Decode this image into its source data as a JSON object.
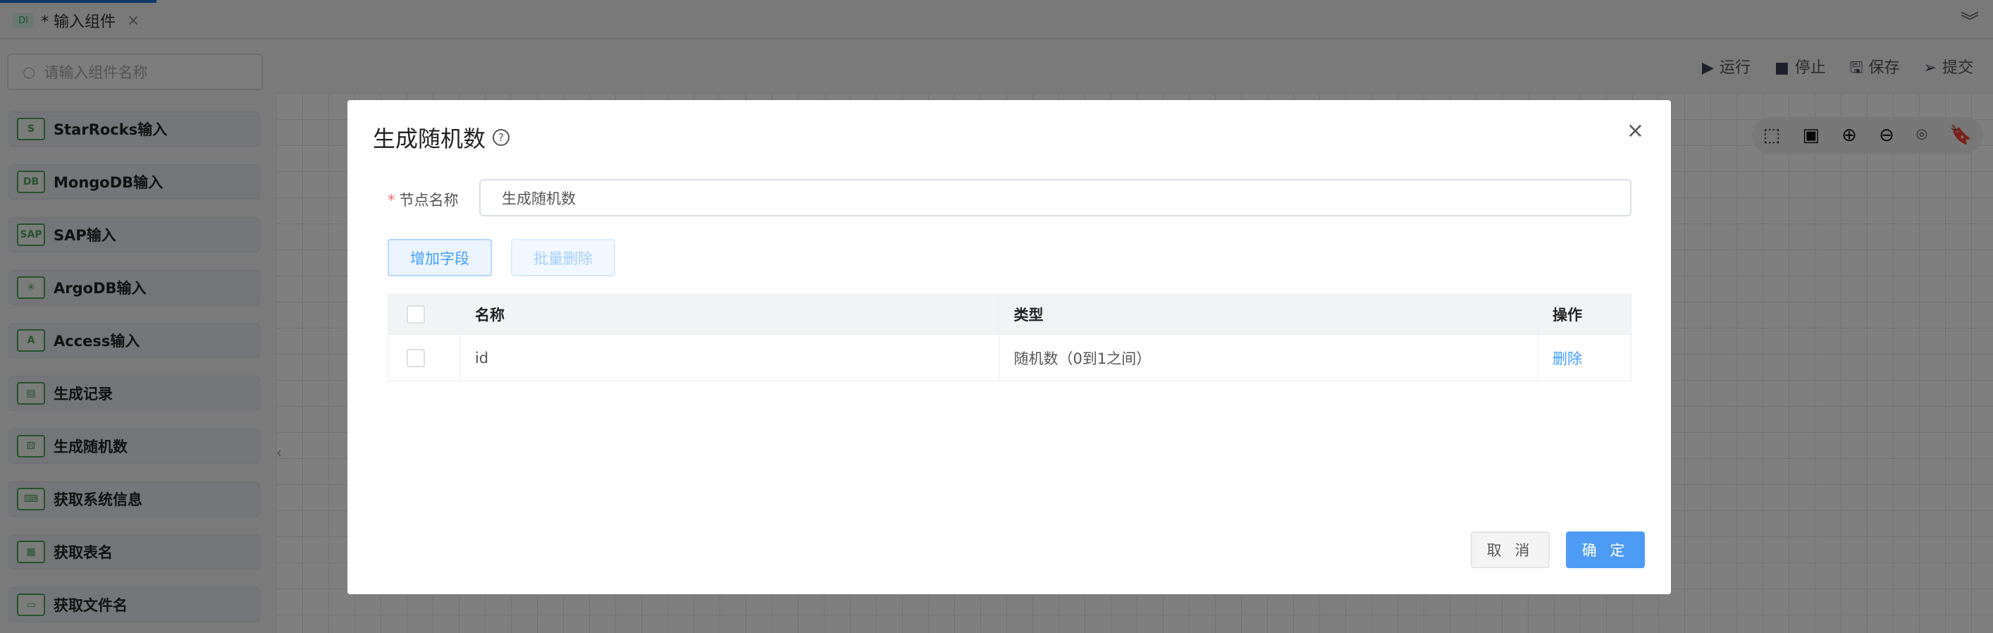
{
  "tab": {
    "badge": "DI",
    "title": "* 输入组件",
    "close": "×"
  },
  "collapse_icon": "︾",
  "search": {
    "placeholder": "请输入组件名称"
  },
  "actions": [
    {
      "icon": "▶",
      "label": "运行"
    },
    {
      "icon": "■",
      "label": "停止"
    },
    {
      "icon": "🖫",
      "label": "保存"
    },
    {
      "icon": "➢",
      "label": "提交"
    }
  ],
  "sidebar": {
    "items": [
      {
        "label": "StarRocks输入",
        "icon": "S"
      },
      {
        "label": "MongoDB输入",
        "icon": "DB"
      },
      {
        "label": "SAP输入",
        "icon": "SAP"
      },
      {
        "label": "ArgoDB输入",
        "icon": "✳"
      },
      {
        "label": "Access输入",
        "icon": "A"
      },
      {
        "label": "生成记录",
        "icon": "▤"
      },
      {
        "label": "生成随机数",
        "icon": "⚄"
      },
      {
        "label": "获取系统信息",
        "icon": "⌨"
      },
      {
        "label": "获取表名",
        "icon": "▦"
      },
      {
        "label": "获取文件名",
        "icon": "▭"
      }
    ]
  },
  "zoom_tools": [
    "⬚",
    "▣",
    "⊕",
    "⊖",
    "⌾",
    "🔖"
  ],
  "modal": {
    "title": "生成随机数",
    "help": "?",
    "close": "×",
    "field_label": "节点名称",
    "required": "*",
    "field_value": "生成随机数",
    "add_button": "增加字段",
    "batch_delete_button": "批量删除",
    "table": {
      "headers": [
        "名称",
        "类型",
        "操作"
      ],
      "rows": [
        {
          "name": "id",
          "type": "随机数（0到1之间）",
          "action": "删除"
        }
      ]
    },
    "cancel": "取 消",
    "ok": "确 定"
  }
}
